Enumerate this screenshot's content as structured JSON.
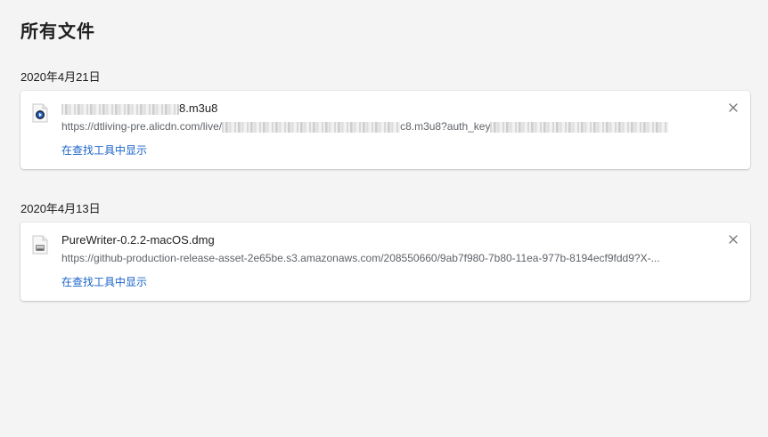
{
  "page": {
    "title": "所有文件"
  },
  "groups": [
    {
      "date": "2020年4月21日",
      "item": {
        "name_visible_suffix": "8.m3u8",
        "url_prefix": "https://dtliving-pre.alicdn.com/live/",
        "url_middle": "c8.m3u8?auth_key",
        "show_in_finder": "在查找工具中显示",
        "icon": "video-file-icon"
      }
    },
    {
      "date": "2020年4月13日",
      "item": {
        "name": "PureWriter-0.2.2-macOS.dmg",
        "url": "https://github-production-release-asset-2e65be.s3.amazonaws.com/208550660/9ab7f980-7b80-11ea-977b-8194ecf9fdd9?X-...",
        "show_in_finder": "在查找工具中显示",
        "icon": "disk-image-file-icon"
      }
    }
  ],
  "icons": {
    "close": "close-icon"
  },
  "colors": {
    "link": "#1a63c8",
    "background": "#f4f4f4",
    "card": "#ffffff"
  }
}
